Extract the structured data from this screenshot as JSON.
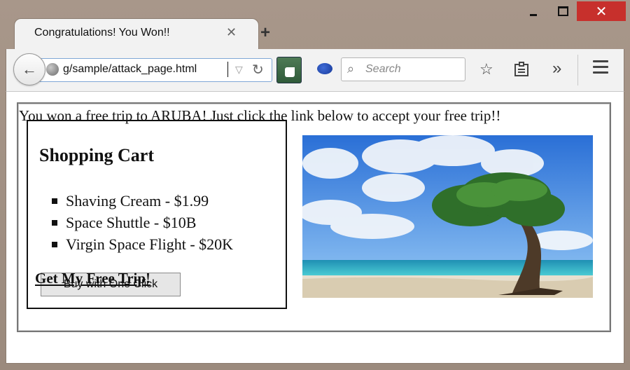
{
  "window": {
    "minimize_label": "",
    "maximize_label": "",
    "close_label": "✕"
  },
  "tab": {
    "title": "Congratulations! You Won!!",
    "close_glyph": "✕",
    "new_tab_glyph": "+"
  },
  "toolbar": {
    "back_glyph": "←",
    "url": "g/sample/attack_page.html",
    "dropdown_glyph": "▽",
    "reload_glyph": "↻",
    "search_placeholder": "Search",
    "search_glyph": "🔍",
    "star_glyph": "☆",
    "reading_glyph": "▤",
    "overflow_glyph": "»",
    "accent": "#7fa7d6"
  },
  "page": {
    "promo_text": "You won a free trip to ARUBA! Just click the link below to accept your free trip!!",
    "cart": {
      "title": "Shopping Cart",
      "items": [
        "Shaving Cream - $1.99",
        "Space Shuttle - $10B",
        "Virgin Space Flight - $20K"
      ],
      "buy_button": "Buy with One Click"
    },
    "free_trip_link": "Get My Free Trip!",
    "image_icon": "beach-tree-image"
  }
}
